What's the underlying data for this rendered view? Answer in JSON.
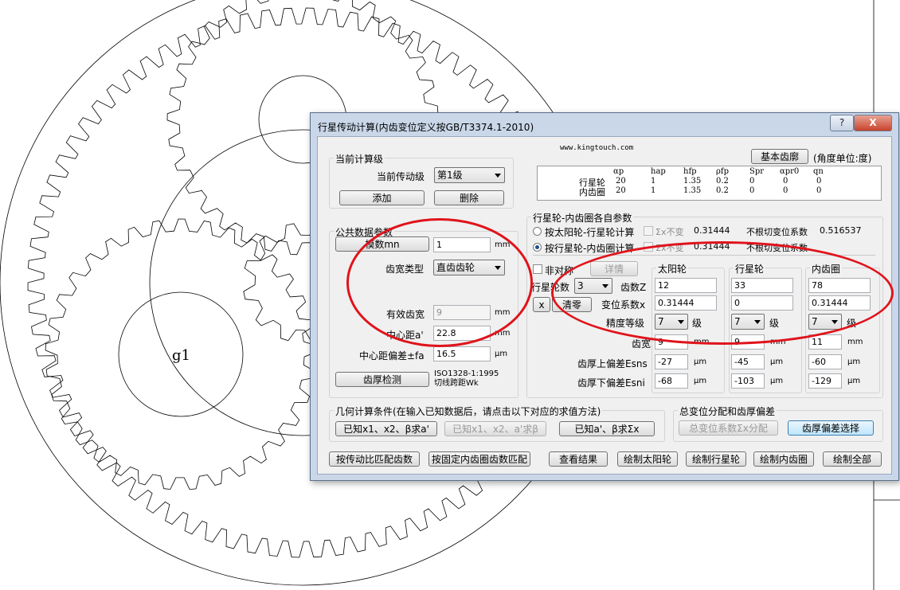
{
  "cad": {
    "gear_label": "g1"
  },
  "dialog": {
    "title": "行星传动计算(内齿变位定义按GB/T3374.1-2010)",
    "help": "?",
    "close": "X",
    "website": "www.kingtouch.com",
    "basic_profile_btn": "基本齿廓",
    "angle_unit": "(角度单位:度)"
  },
  "current_stage": {
    "group_title": "当前计算级",
    "label": "当前传动级",
    "value": "第1级",
    "add_btn": "添加",
    "delete_btn": "删除"
  },
  "param_table": {
    "headers": [
      "αp",
      "hap",
      "hfp",
      "ρfp",
      "Spr",
      "αpr0",
      "qn"
    ],
    "rows": [
      {
        "name": "行星轮",
        "values": [
          "20",
          "1",
          "1.35",
          "0.2",
          "0",
          "0",
          "0"
        ]
      },
      {
        "name": "内齿圈",
        "values": [
          "20",
          "1",
          "1.35",
          "0.2",
          "0",
          "0",
          "0"
        ]
      }
    ]
  },
  "common": {
    "group_title": "公共数据参数",
    "module_btn": "模数mn",
    "module_value": "1",
    "module_unit": "mm",
    "gear_type_label": "齿宽类型",
    "gear_type_value": "直齿齿轮",
    "eff_width_label": "有效齿宽",
    "eff_width_value": "9",
    "eff_width_unit": "mm",
    "center_dist_label": "中心距a'",
    "center_dist_value": "22.8",
    "center_dist_unit": "mm",
    "center_dev_label": "中心距偏差±fa",
    "center_dev_value": "16.5",
    "center_dev_unit": "μm",
    "thickness_btn": "齿厚检测",
    "iso_line1": "ISO1328-1:1995",
    "iso_line2": "切线跨距Wk"
  },
  "planet_ring": {
    "group_title": "行星轮-内齿圈各自参数",
    "radio1": "按太阳轮-行星轮计算",
    "radio2": "按行星轮-内齿圈计算",
    "sigma_unchanged1": "Σx不变",
    "sigma_value1": "0.31444",
    "no_undercut1": "不根切变位系数",
    "no_undercut_value1": "0.516537",
    "sigma_unchanged2": "Σx不变",
    "sigma_value2": "0.31444",
    "no_undercut2": "不根切变位系数",
    "asym_label": "非对称",
    "detail_btn": "详情",
    "planet_count_label": "行星轮数",
    "planet_count_value": "3",
    "x_btn": "x",
    "clear_btn": "清零",
    "cols": [
      "太阳轮",
      "行星轮",
      "内齿圈"
    ],
    "teeth_label": "齿数Z",
    "teeth": [
      "12",
      "33",
      "78"
    ],
    "shift_label": "变位系数x",
    "shift": [
      "0.31444",
      "0",
      "0.31444"
    ],
    "grade_label": "精度等级",
    "grade": [
      "7",
      "7",
      "7"
    ],
    "grade_unit": "级",
    "width_label": "齿宽",
    "width": [
      "9",
      "9",
      "11"
    ],
    "width_unit": "mm",
    "upper_label": "齿厚上偏差Esns",
    "upper": [
      "-27",
      "-45",
      "-60"
    ],
    "lower_label": "齿厚下偏差Esni",
    "lower": [
      "-68",
      "-103",
      "-129"
    ],
    "dev_unit": "μm"
  },
  "geometry": {
    "group_title": "几何计算条件(在输入已知数据后，请点击以下对应的求值方法)",
    "btn1": "已知x1、x2、β求a'",
    "btn2": "已知x1、x2、a'求β",
    "btn3": "已知a'、β求Σx"
  },
  "shift_dist": {
    "group_title": "总变位分配和齿厚偏差",
    "btn1": "总变位系数Σx分配",
    "btn2": "齿厚偏差选择"
  },
  "bottom": {
    "btn1": "按传动比匹配齿数",
    "btn2": "按固定内齿圈齿数匹配",
    "btn3": "查看结果",
    "btn4": "绘制太阳轮",
    "btn5": "绘制行星轮",
    "btn6": "绘制内齿圈",
    "btn7": "绘制全部"
  },
  "colors": {
    "annotation_red": "#e0131b",
    "title_bar": "#c9d7e9"
  }
}
